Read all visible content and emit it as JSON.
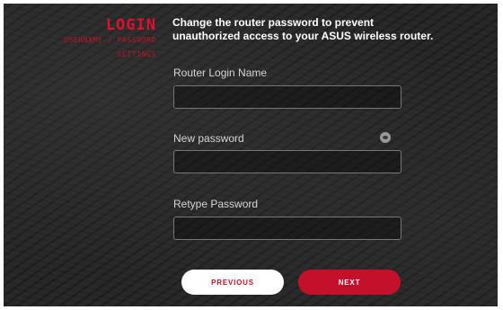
{
  "sidebar": {
    "title": "LOGIN",
    "step_username": "USERNAME / PASSWORD",
    "step_settings": "SETTINGS"
  },
  "description": "Change the router password to prevent unauthorized access to your ASUS wireless router.",
  "form": {
    "login_name_label": "Router Login Name",
    "login_name_value": "",
    "new_password_label": "New password",
    "new_password_value": "",
    "retype_password_label": "Retype Password",
    "retype_password_value": ""
  },
  "buttons": {
    "previous": "PREVIOUS",
    "next": "NEXT"
  },
  "colors": {
    "accent": "#c4102a",
    "title": "#e0102f",
    "background": "#262626"
  },
  "icons": {
    "password_visibility": "eye-icon"
  }
}
